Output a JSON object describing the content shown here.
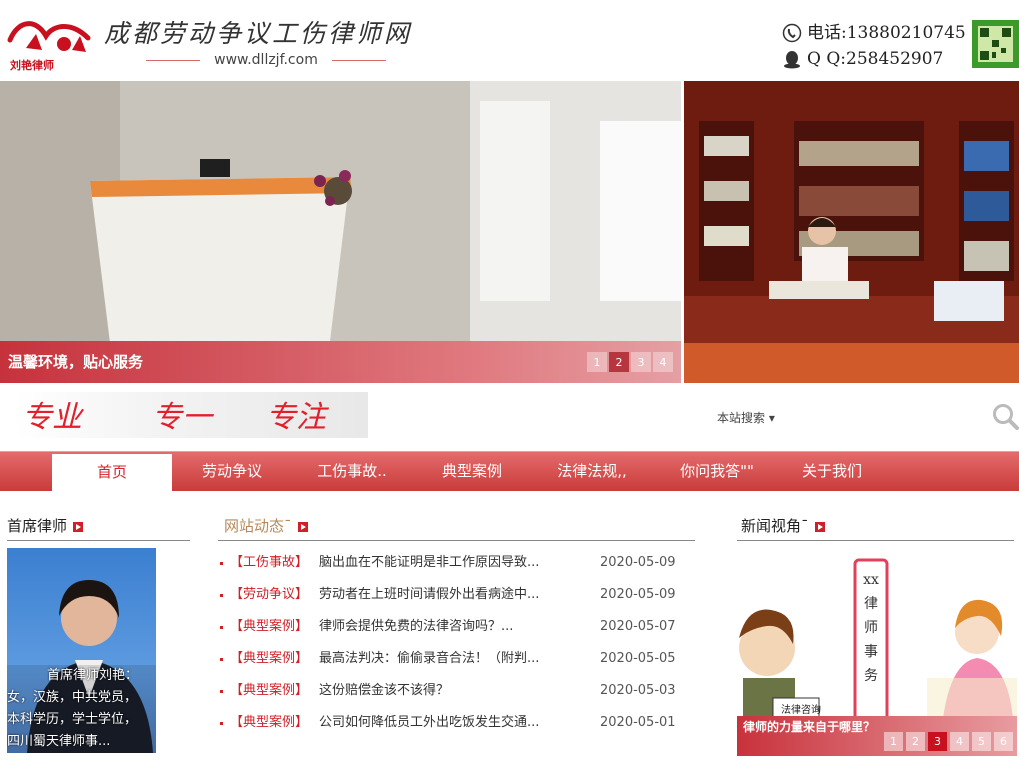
{
  "header": {
    "logo_sub": "刘艳律师",
    "site_title": "成都劳动争议工伤律师网",
    "site_url": "www.dllzjf.com",
    "phone": "电话:13880210745",
    "qq": "Q  Q:258452907"
  },
  "banner": {
    "caption": "温馨环境，贴心服务",
    "pager": [
      "1",
      "2",
      "3",
      "4"
    ],
    "active_page": "2"
  },
  "slogan": [
    "专业",
    "专一",
    "专注"
  ],
  "search": {
    "label": "本站搜索 ▾"
  },
  "nav": {
    "items": [
      {
        "label": "首页",
        "active": true
      },
      {
        "label": "劳动争议"
      },
      {
        "label": "工伤事故.."
      },
      {
        "label": "典型案例"
      },
      {
        "label": "法律法规,,"
      },
      {
        "label": "你问我答\"\""
      },
      {
        "label": "关于我们"
      }
    ]
  },
  "lawyer_section": {
    "title": "首席律师",
    "bio_lines": [
      "首席律师刘艳：",
      "女，汉族，中共党员，",
      "本科学历，学士学位，",
      "四川蜀天律师事..."
    ]
  },
  "news_section": {
    "title": "网站动态ˉ",
    "items": [
      {
        "category": "【工伤事故】",
        "title": "脑出血在不能证明是非工作原因导致...",
        "date": "2020-05-09"
      },
      {
        "category": "【劳动争议】",
        "title": "劳动者在上班时间请假外出看病途中...",
        "date": "2020-05-09"
      },
      {
        "category": "【典型案例】",
        "title": "律师会提供免费的法律咨询吗？...",
        "date": "2020-05-07"
      },
      {
        "category": "【典型案例】",
        "title": "最高法判决：偷偷录音合法！（附判...",
        "date": "2020-05-05"
      },
      {
        "category": "【典型案例】",
        "title": "这份赔偿金该不该得？",
        "date": "2020-05-03"
      },
      {
        "category": "【典型案例】",
        "title": "公司如何降低员工外出吃饭发生交通...",
        "date": "2020-05-01"
      }
    ]
  },
  "media_section": {
    "title": "新闻视角ˉ",
    "caption": "律师的力量来自于哪里？",
    "sign_text": "xx律师事务",
    "bubble": "法律咨询",
    "pager": [
      "1",
      "2",
      "3",
      "4",
      "5",
      "6"
    ],
    "active_page": "3"
  }
}
